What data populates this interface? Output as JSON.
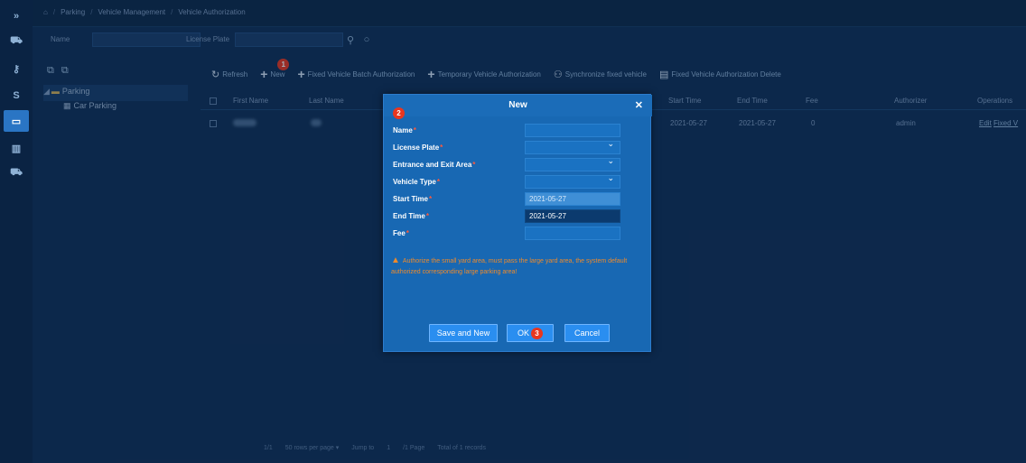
{
  "breadcrumb": {
    "home_icon": "home-icon",
    "items": [
      "Parking",
      "Vehicle Management",
      "Vehicle Authorization"
    ]
  },
  "filters": {
    "name_label": "Name",
    "plate_label": "License Plate",
    "name_value": "",
    "plate_value": ""
  },
  "tree": {
    "root": "Parking",
    "child": "Car Parking"
  },
  "toolbar": {
    "refresh": "Refresh",
    "new": "New",
    "fixed_batch": "Fixed Vehicle Batch Authorization",
    "temporary": "Temporary Vehicle Authorization",
    "sync": "Synchronize fixed vehicle",
    "fixed_delete": "Fixed Vehicle Authorization  Delete"
  },
  "badges": {
    "b1": "1",
    "b2": "2",
    "b3": "3"
  },
  "table": {
    "headers": {
      "first_name": "First Name",
      "last_name": "Last Name",
      "start": "Start Time",
      "end": "End Time",
      "fee": "Fee",
      "authorizer": "Authorizer",
      "operations": "Operations"
    },
    "row": {
      "start": "2021-05-27",
      "end": "2021-05-27",
      "fee": "0",
      "authorizer": "admin",
      "op_edit": "Edit",
      "op_fixed": "Fixed V"
    }
  },
  "pager": {
    "pages": "1/1",
    "per_page": "50 rows per page",
    "jump": "Jump to",
    "jump_value": "1",
    "page_suffix": "/1 Page",
    "total": "Total of 1 records"
  },
  "modal": {
    "title": "New",
    "labels": {
      "name": "Name",
      "plate": "License Plate",
      "area": "Entrance and Exit Area",
      "vtype": "Vehicle Type",
      "start": "Start Time",
      "end": "End Time",
      "fee": "Fee"
    },
    "values": {
      "name": "",
      "plate": "",
      "area": "",
      "vtype": "",
      "start": "2021-05-27",
      "end": "2021-05-27",
      "fee": ""
    },
    "warning": "Authorize the small yard area, must pass the large yard area, the system default authorized corresponding large parking area!",
    "buttons": {
      "save_new": "Save and New",
      "ok": "OK",
      "cancel": "Cancel"
    }
  },
  "colors": {
    "accent": "#2a8ef0",
    "badge": "#e8361f",
    "warning": "#f08a2a",
    "bg": "#0f2f56"
  }
}
